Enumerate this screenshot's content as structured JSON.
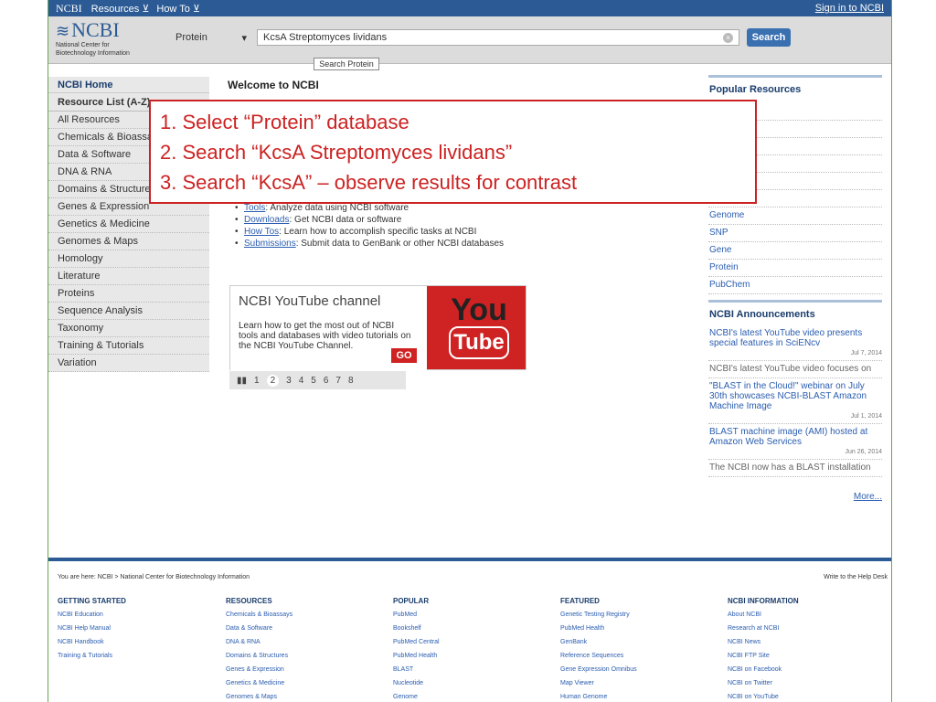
{
  "topbar": {
    "logo": "NCBI",
    "menu1": "Resources",
    "menu2": "How To",
    "signin": "Sign in to NCBI"
  },
  "header": {
    "brand": "NCBI",
    "brand_sub1": "National Center for",
    "brand_sub2": "Biotechnology Information",
    "db_selected": "Protein",
    "search_value": "KcsA Streptomyces lividans",
    "search_button": "Search",
    "tooltip": "Search Protein"
  },
  "sidebar": {
    "home": "NCBI Home",
    "resource_list": "Resource List (A-Z)",
    "items": [
      "All Resources",
      "Chemicals & Bioassa",
      "Data & Software",
      "DNA & RNA",
      "Domains & Structures",
      "Genes & Expression",
      "Genetics & Medicine",
      "Genomes & Maps",
      "Homology",
      "Literature",
      "Proteins",
      "Sequence Analysis",
      "Taxonomy",
      "Training & Tutorials",
      "Variation"
    ]
  },
  "main": {
    "welcome": "Welcome to NCBI",
    "bullets": [
      {
        "link": "Tools",
        "text": ": Analyze data using NCBI software"
      },
      {
        "link": "Downloads",
        "text": ": Get NCBI data or software"
      },
      {
        "link": "How Tos",
        "text": ": Learn how to accomplish specific tasks at NCBI"
      },
      {
        "link": "Submissions",
        "text": ": Submit data to GenBank or other NCBI databases"
      }
    ],
    "youtube": {
      "title": "NCBI YouTube channel",
      "desc": "Learn how to get the most out of NCBI tools and databases with video tutorials on the NCBI YouTube Channel.",
      "go": "GO",
      "logo_you": "You",
      "logo_tube": "Tube"
    },
    "pager": [
      "1",
      "2",
      "3",
      "4",
      "5",
      "6",
      "7",
      "8"
    ],
    "pager_current": "2"
  },
  "right": {
    "popular_title": "Popular Resources",
    "popular": [
      "",
      "",
      "ntral",
      "alth",
      "",
      "",
      "Genome",
      "SNP",
      "Gene",
      "Protein",
      "PubChem"
    ],
    "ann_title": "NCBI Announcements",
    "announcements": [
      {
        "text": "NCBI's latest YouTube video presents special features in SciENcv",
        "date": "Jul 7, 2014"
      },
      {
        "text": "NCBI's latest YouTube video focuses on",
        "date": ""
      },
      {
        "text": "\"BLAST in the Cloud!\" webinar on July 30th showcases NCBI-BLAST Amazon Machine Image",
        "date": "Jul 1, 2014"
      },
      {
        "text": "BLAST machine image (AMI) hosted at Amazon Web Services",
        "date": "Jun 26, 2014"
      },
      {
        "text": "The NCBI now has a BLAST installation",
        "date": ""
      }
    ],
    "more": "More..."
  },
  "footer": {
    "breadcrumb": "You are here: NCBI > National Center for Biotechnology Information",
    "helpdesk": "Write to the Help Desk",
    "columns": [
      {
        "head": "GETTING STARTED",
        "items": [
          "NCBI Education",
          "NCBI Help Manual",
          "NCBI Handbook",
          "Training & Tutorials"
        ]
      },
      {
        "head": "RESOURCES",
        "items": [
          "Chemicals & Bioassays",
          "Data & Software",
          "DNA & RNA",
          "Domains & Structures",
          "Genes & Expression",
          "Genetics & Medicine",
          "Genomes & Maps"
        ]
      },
      {
        "head": "POPULAR",
        "items": [
          "PubMed",
          "Bookshelf",
          "PubMed Central",
          "PubMed Health",
          "BLAST",
          "Nucleotide",
          "Genome"
        ]
      },
      {
        "head": "FEATURED",
        "items": [
          "Genetic Testing Registry",
          "PubMed Health",
          "GenBank",
          "Reference Sequences",
          "Gene Expression Omnibus",
          "Map Viewer",
          "Human Genome"
        ]
      },
      {
        "head": "NCBI INFORMATION",
        "items": [
          "About NCBI",
          "Research at NCBI",
          "NCBI News",
          "NCBI FTP Site",
          "NCBI on Facebook",
          "NCBI on Twitter",
          "NCBI on YouTube"
        ]
      }
    ]
  },
  "annotation": {
    "steps": [
      "1. Select “Protein” database",
      "2. Search “KcsA Streptomyces lividans”",
      "3. Search “KcsA” – observe results for contrast"
    ]
  }
}
